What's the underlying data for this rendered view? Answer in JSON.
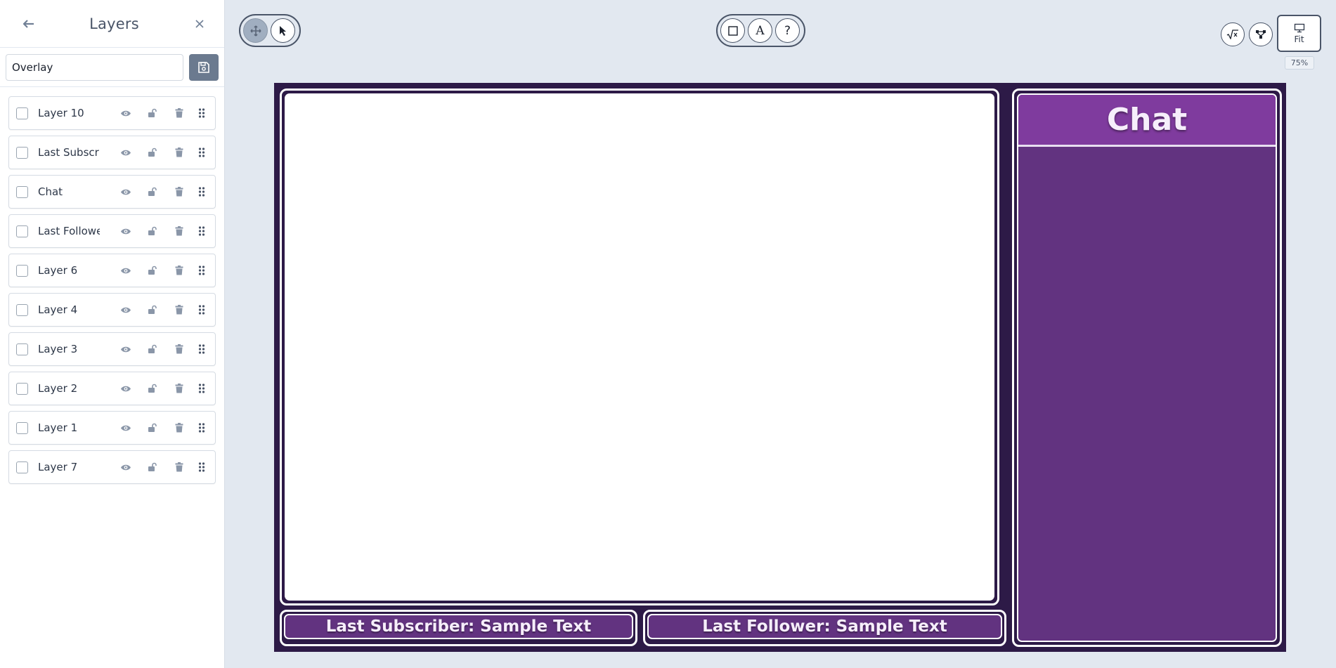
{
  "sidebar": {
    "title": "Layers",
    "back_icon": "back-arrow-icon",
    "close_icon": "close-icon",
    "overlay_name": "Overlay",
    "save_icon": "save-icon",
    "layers": [
      {
        "name": "Layer 10"
      },
      {
        "name": "Last Subscriber"
      },
      {
        "name": "Chat"
      },
      {
        "name": "Last Follower"
      },
      {
        "name": "Layer 6"
      },
      {
        "name": "Layer 4"
      },
      {
        "name": "Layer 3"
      },
      {
        "name": "Layer 2"
      },
      {
        "name": "Layer 1"
      },
      {
        "name": "Layer 7"
      }
    ]
  },
  "toolbar": {
    "left_tools": [
      "move-icon",
      "pointer-icon"
    ],
    "center_tools": [
      "rectangle-icon",
      "text-icon",
      "help-icon"
    ],
    "text_tool_glyph": "A",
    "help_tool_glyph": "?",
    "right_tools": [
      "sqrt-icon",
      "nodes-icon"
    ],
    "fit_label": "Fit",
    "zoom": "75%"
  },
  "canvas": {
    "chat_title": "Chat",
    "subscriber_text": "Last Subscriber: Sample Text",
    "follower_text": "Last Follower: Sample Text"
  },
  "colors": {
    "canvas_bg": "#2d1a47",
    "panel_purple": "#623380",
    "header_purple": "#7f3b9e",
    "app_bg": "#e2e8f0",
    "save_button": "#6b7a8f"
  }
}
